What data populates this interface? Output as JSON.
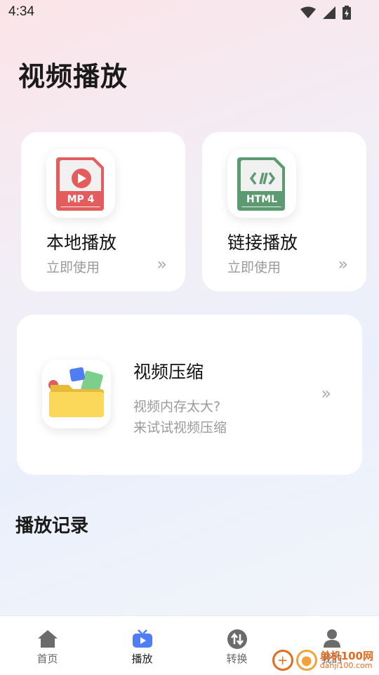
{
  "status_bar": {
    "time": "4:34"
  },
  "page_title": "视频播放",
  "cards": {
    "local": {
      "title": "本地播放",
      "subtitle": "立即使用",
      "icon_label": "MP 4",
      "arrows": "»"
    },
    "link": {
      "title": "链接播放",
      "subtitle": "立即使用",
      "icon_label": "HTML",
      "arrows": "»"
    },
    "compress": {
      "title": "视频压缩",
      "desc_line1": "视频内存太大?",
      "desc_line2": "来试试视频压缩",
      "arrows": "»"
    }
  },
  "section": {
    "history_title": "播放记录"
  },
  "tabbar": {
    "tabs": [
      {
        "label": "首页",
        "icon": "home-icon"
      },
      {
        "label": "播放",
        "icon": "tv-play-icon",
        "active": true
      },
      {
        "label": "转换",
        "icon": "convert-icon"
      },
      {
        "label": "我的",
        "icon": "person-icon"
      }
    ]
  },
  "watermark": {
    "top": "单机100网",
    "bottom": "danji100.com"
  },
  "colors": {
    "accent": "#4f7df3",
    "red_file": "#e35d5d",
    "green_file": "#5c9a72",
    "muted_text": "#9a9a9a"
  }
}
